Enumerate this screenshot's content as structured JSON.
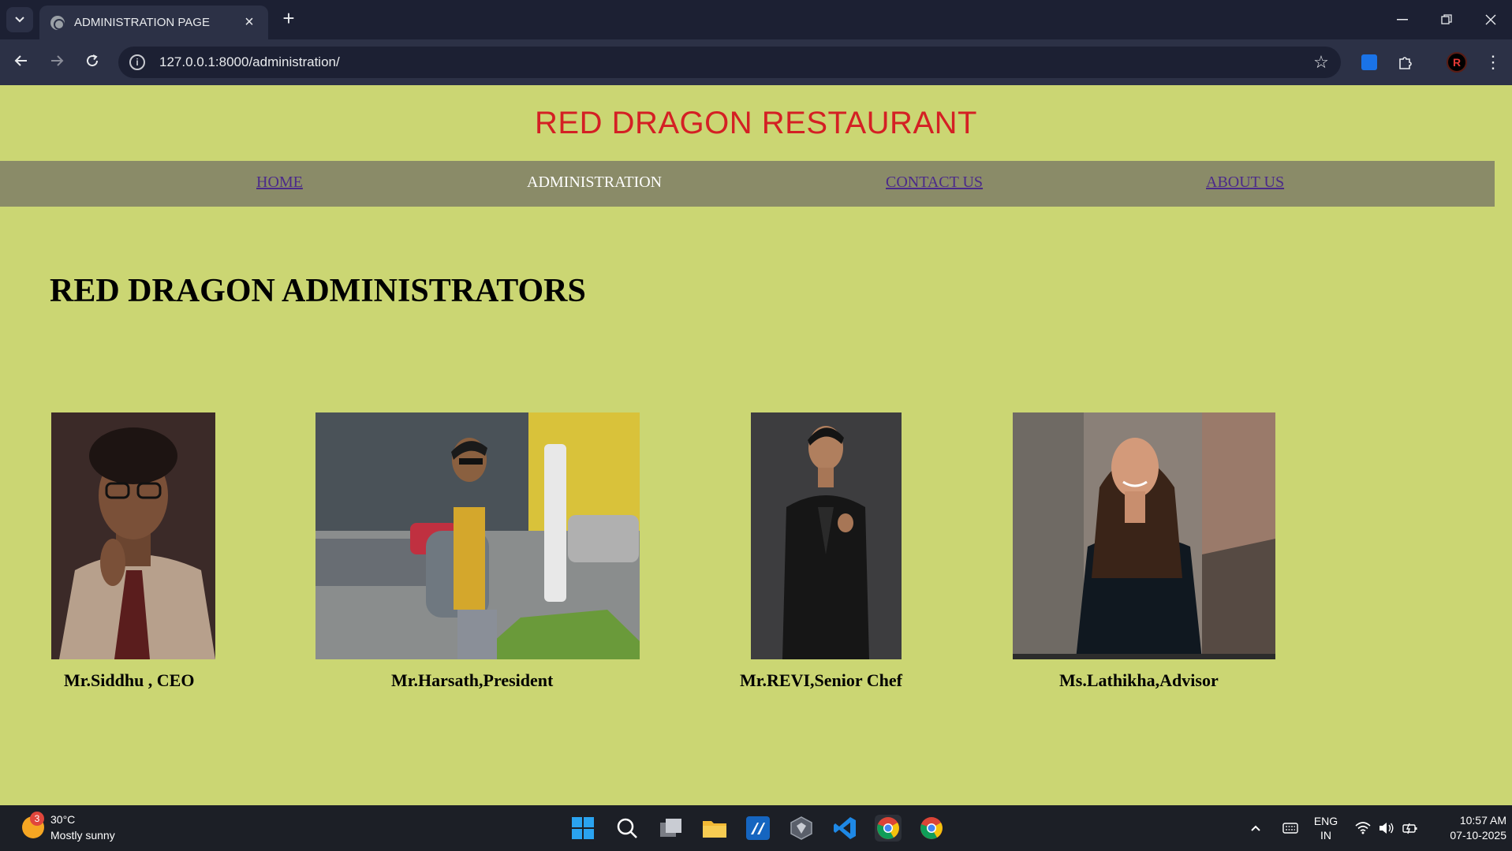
{
  "browser": {
    "tab_title": "ADMINISTRATION PAGE",
    "url": "127.0.0.1:8000/administration/",
    "avatar_letter": "R"
  },
  "site": {
    "title": "RED DRAGON RESTAURANT",
    "nav": {
      "home": "HOME",
      "administration": "ADMINISTRATION",
      "contact": "CONTACT US",
      "about": "ABOUT US"
    },
    "heading": "RED DRAGON ADMINISTRATORS",
    "people": [
      {
        "caption": "Mr.Siddhu , CEO"
      },
      {
        "caption": "Mr.Harsath,President"
      },
      {
        "caption": "Mr.REVI,Senior Chef"
      },
      {
        "caption": "Ms.Lathikha,Advisor"
      }
    ]
  },
  "taskbar": {
    "weather_badge": "3",
    "temperature": "30°C",
    "weather": "Mostly sunny",
    "lang_line1": "ENG",
    "lang_line2": "IN",
    "time": "10:57 AM",
    "date": "07-10-2025"
  },
  "colors": {
    "page_bg": "#cbd673",
    "nav_bg": "#8a8b68",
    "title_red": "#d42024"
  }
}
